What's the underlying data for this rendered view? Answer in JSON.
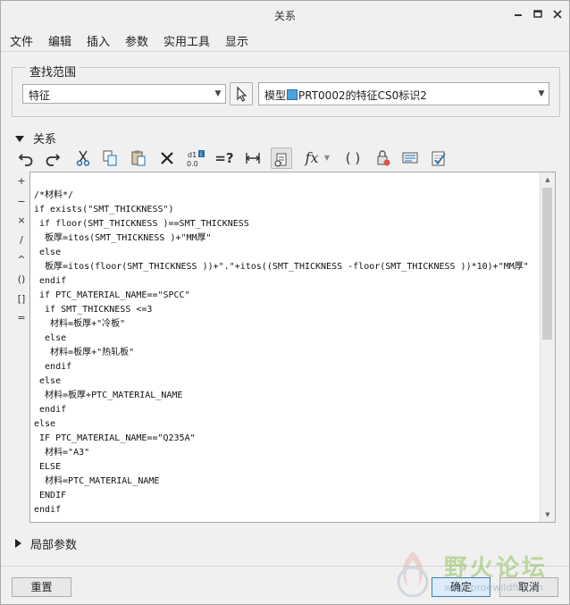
{
  "window": {
    "title": "关系"
  },
  "menu": {
    "file": "文件",
    "edit": "编辑",
    "insert": "插入",
    "params": "参数",
    "utilities": "实用工具",
    "display": "显示"
  },
  "scope": {
    "legend": "查找范围",
    "type_value": "特征",
    "model_prefix": "模型",
    "model_value": "PRT0002的特征CS0标识2"
  },
  "relations": {
    "header": "关系",
    "toolbar_icons": [
      "undo-icon",
      "redo-icon",
      "cut-icon",
      "copy-icon",
      "paste-icon",
      "delete-icon",
      "switch-symbols-icon",
      "verify-icon",
      "measure-icon",
      "properties-icon",
      "function-icon",
      "parentheses-icon",
      "lock-icon",
      "display-icon",
      "check-icon"
    ],
    "operators": [
      "+",
      "−",
      "×",
      "/",
      "^",
      "()",
      "[]",
      "="
    ],
    "code": "/*材料*/\nif exists(\"SMT_THICKNESS\")\n if floor(SMT_THICKNESS )==SMT_THICKNESS\n  板厚=itos(SMT_THICKNESS )+\"MM厚\"\n else\n  板厚=itos(floor(SMT_THICKNESS ))+\".\"+itos((SMT_THICKNESS -floor(SMT_THICKNESS ))*10)+\"MM厚\"\n endif\n if PTC_MATERIAL_NAME==\"SPCC\"\n  if SMT_THICKNESS <=3\n   材料=板厚+\"冷板\"\n  else\n   材料=板厚+\"热轧板\"\n  endif\n else\n  材料=板厚+PTC_MATERIAL_NAME\n endif\nelse\n IF PTC_MATERIAL_NAME==\"Q235A\"\n  材料=\"A3\"\n ELSE\n  材料=PTC_MATERIAL_NAME\n ENDIF\nendif"
  },
  "local_params": {
    "header": "局部参数"
  },
  "buttons": {
    "reset": "重置",
    "ok": "确定",
    "cancel": "取消"
  },
  "watermark": {
    "text": "野火论坛",
    "url": "www.proewildfire.cn"
  },
  "colors": {
    "accent": "#3c7fb1",
    "watermark_green": "#8fc15a"
  }
}
